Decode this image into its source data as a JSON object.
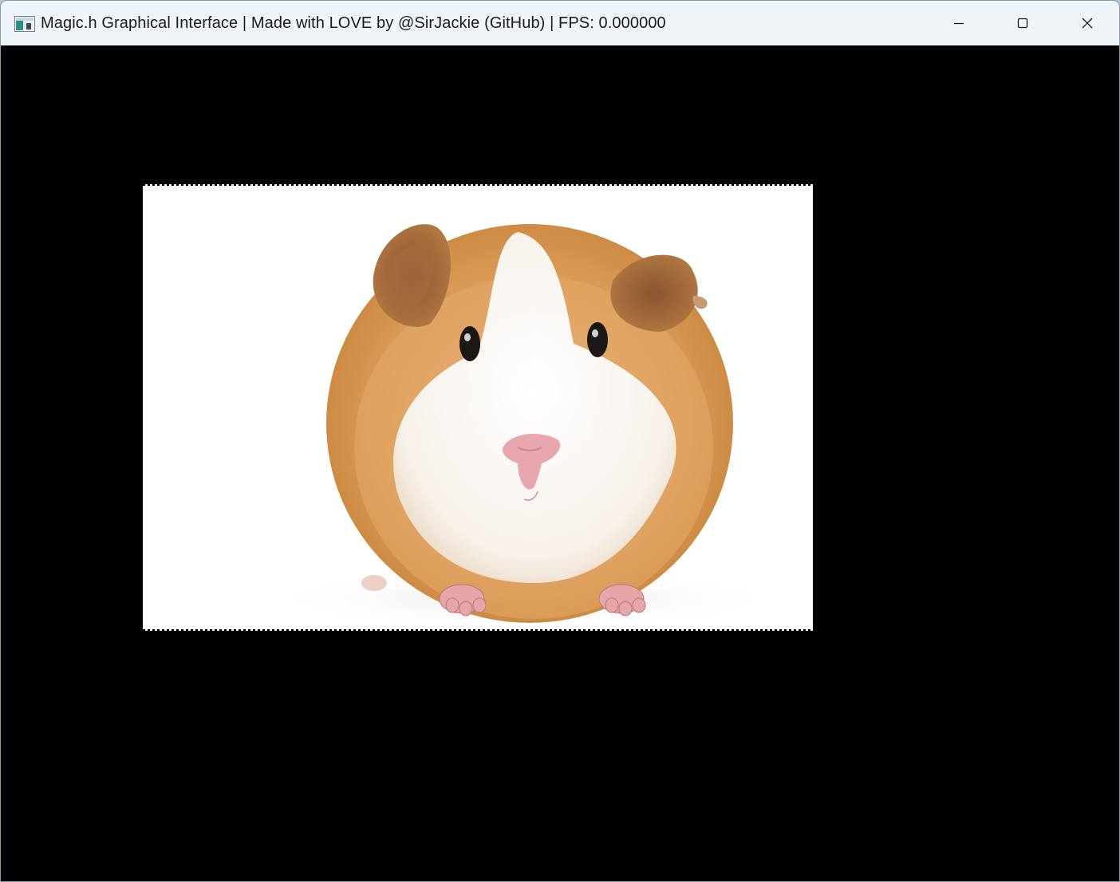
{
  "window": {
    "title": "Magic.h Graphical Interface | Made with LOVE by @SirJackie (GitHub) | FPS: 0.000000",
    "controls": {
      "minimize": "minimize-icon",
      "maximize": "maximize-icon",
      "close": "close-icon"
    }
  },
  "canvas": {
    "background": "#000000",
    "image": "guinea-pig-photo"
  },
  "colors": {
    "titlebar": "#eff4f9",
    "fur_orange": "#d99a55",
    "fur_white": "#fbf8f4",
    "nose_pink": "#e8a7ae"
  }
}
